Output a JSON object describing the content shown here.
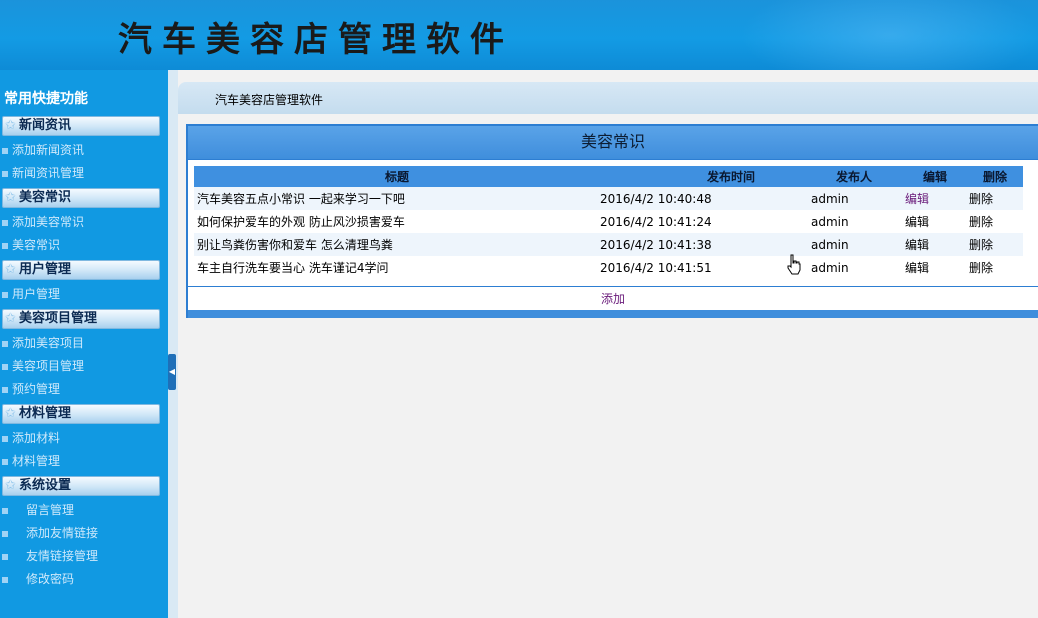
{
  "header": {
    "title": "汽车美容店管理软件"
  },
  "sidebar": {
    "title": "常用快捷功能",
    "groups": [
      {
        "label": "新闻资讯",
        "items": [
          "添加新闻资讯",
          "新闻资讯管理"
        ]
      },
      {
        "label": "美容常识",
        "items": [
          "添加美容常识",
          "美容常识"
        ]
      },
      {
        "label": "用户管理",
        "items": [
          "用户管理"
        ]
      },
      {
        "label": "美容项目管理",
        "items": [
          "添加美容项目",
          "美容项目管理",
          "预约管理"
        ]
      },
      {
        "label": "材料管理",
        "items": [
          "添加材料",
          "材料管理"
        ]
      },
      {
        "label": "系统设置",
        "items": [
          "留言管理",
          "添加友情链接",
          "友情链接管理",
          "修改密码"
        ]
      }
    ]
  },
  "breadcrumb": "汽车美容店管理软件",
  "panel": {
    "title": "美容常识",
    "columns": [
      "标题",
      "发布时间",
      "发布人",
      "编辑",
      "删除"
    ],
    "rows": [
      {
        "title": "汽车美容五点小常识 一起来学习一下吧",
        "time": "2016/4/2 10:40:48",
        "author": "admin",
        "edit": "编辑",
        "delete": "删除"
      },
      {
        "title": "如何保护爱车的外观 防止风沙损害爱车",
        "time": "2016/4/2 10:41:24",
        "author": "admin",
        "edit": "编辑",
        "delete": "删除"
      },
      {
        "title": "别让鸟粪伤害你和爱车 怎么清理鸟粪",
        "time": "2016/4/2 10:41:38",
        "author": "admin",
        "edit": "编辑",
        "delete": "删除"
      },
      {
        "title": "车主自行洗车要当心 洗车谨记4学问",
        "time": "2016/4/2 10:41:51",
        "author": "admin",
        "edit": "编辑",
        "delete": "删除"
      }
    ],
    "add_label": "添加"
  },
  "colors": {
    "header_bg": "#139be4",
    "sidebar_bg": "#1199e2",
    "table_header": "#3f90e0",
    "visited_link": "#6a1b7a"
  }
}
